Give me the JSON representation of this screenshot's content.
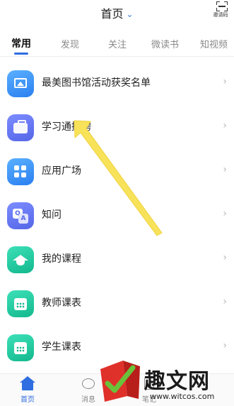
{
  "header": {
    "title": "首页",
    "title_chevron_icon": "chevron-down-icon",
    "invite_code_label": "邀请码",
    "invite_icon": "scan-icon"
  },
  "tabs": [
    {
      "label": "常用",
      "active": true
    },
    {
      "label": "发现",
      "active": false
    },
    {
      "label": "关注",
      "active": false
    },
    {
      "label": "微读书",
      "active": false
    },
    {
      "label": "知视频",
      "active": false
    }
  ],
  "list": [
    {
      "label": "最美图书馆活动获奖名单",
      "icon": "picture-icon",
      "color": "#3a8ff5"
    },
    {
      "label": "学习通招聘",
      "icon": "briefcase-icon",
      "color": "#6474f0"
    },
    {
      "label": "应用广场",
      "icon": "grid-icon",
      "color": "#3a8ff5"
    },
    {
      "label": "知问",
      "icon": "qa-icon",
      "color": "#6474f0"
    },
    {
      "label": "我的课程",
      "icon": "graduation-cap-icon",
      "color": "#1cc497"
    },
    {
      "label": "教师课表",
      "icon": "calendar-icon",
      "color": "#1cc497"
    },
    {
      "label": "学生课表",
      "icon": "calendar-icon",
      "color": "#1cc497"
    }
  ],
  "annotation": {
    "type": "yellow-arrow",
    "points_to": "学习通招聘",
    "color": "#f7e25a"
  },
  "bottom_nav": [
    {
      "label": "首页",
      "icon": "home-icon",
      "active": true
    },
    {
      "label": "消息",
      "icon": "message-icon",
      "active": false
    },
    {
      "label": "笔记",
      "icon": "note-icon",
      "active": false
    }
  ],
  "watermark": {
    "text": "趣文网",
    "url": "www.witcos.com"
  },
  "colors": {
    "accent": "#2f6de1",
    "arrow": "#f7e25a"
  }
}
